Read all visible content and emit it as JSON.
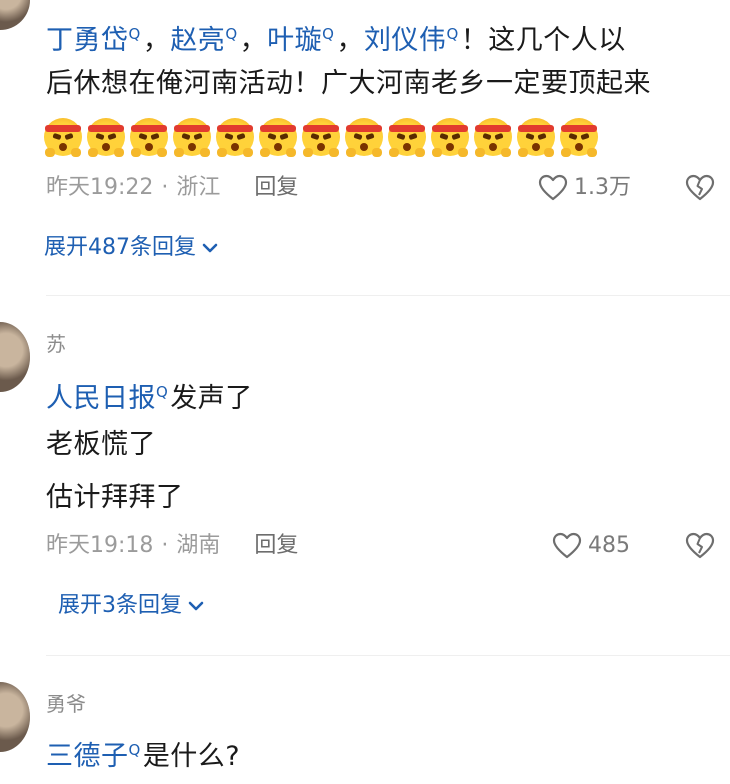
{
  "comments": [
    {
      "text_line1": [
        {
          "t": "丁勇岱",
          "mention": true
        },
        {
          "t": "，",
          "mention": false
        },
        {
          "t": "赵亮",
          "mention": true
        },
        {
          "t": "，",
          "mention": false
        },
        {
          "t": "叶璇",
          "mention": true
        },
        {
          "t": "，",
          "mention": false
        },
        {
          "t": "刘仪伟",
          "mention": true
        },
        {
          "t": "！这几个人以",
          "mention": false
        }
      ],
      "text_line2": "后休想在俺河南活动！广大河南老乡一定要顶起来",
      "emoji_name": "angry-headband-emoji",
      "emoji_count": 13,
      "time": "昨天19:22",
      "location": "浙江",
      "reply_label": "回复",
      "likes": "1.3万",
      "expand_label": "展开487条回复"
    },
    {
      "username": "苏",
      "mention": "人民日报",
      "line1_rest": "发声了",
      "line2": "老板慌了",
      "line3": "估计拜拜了",
      "time": "昨天19:18",
      "location": "湖南",
      "reply_label": "回复",
      "likes": "485",
      "expand_label": "展开3条回复"
    },
    {
      "username": "勇爷",
      "mention": "三德子",
      "line1_rest": "是什么?"
    }
  ],
  "separator": "·",
  "search_glyph": "Q",
  "icons": {
    "like": "heart-outline-icon",
    "dislike": "broken-heart-icon",
    "expand": "chevron-down-icon"
  },
  "colors": {
    "mention": "#1e5fb2",
    "meta": "#9b9b9b",
    "background": "#ffffff"
  }
}
